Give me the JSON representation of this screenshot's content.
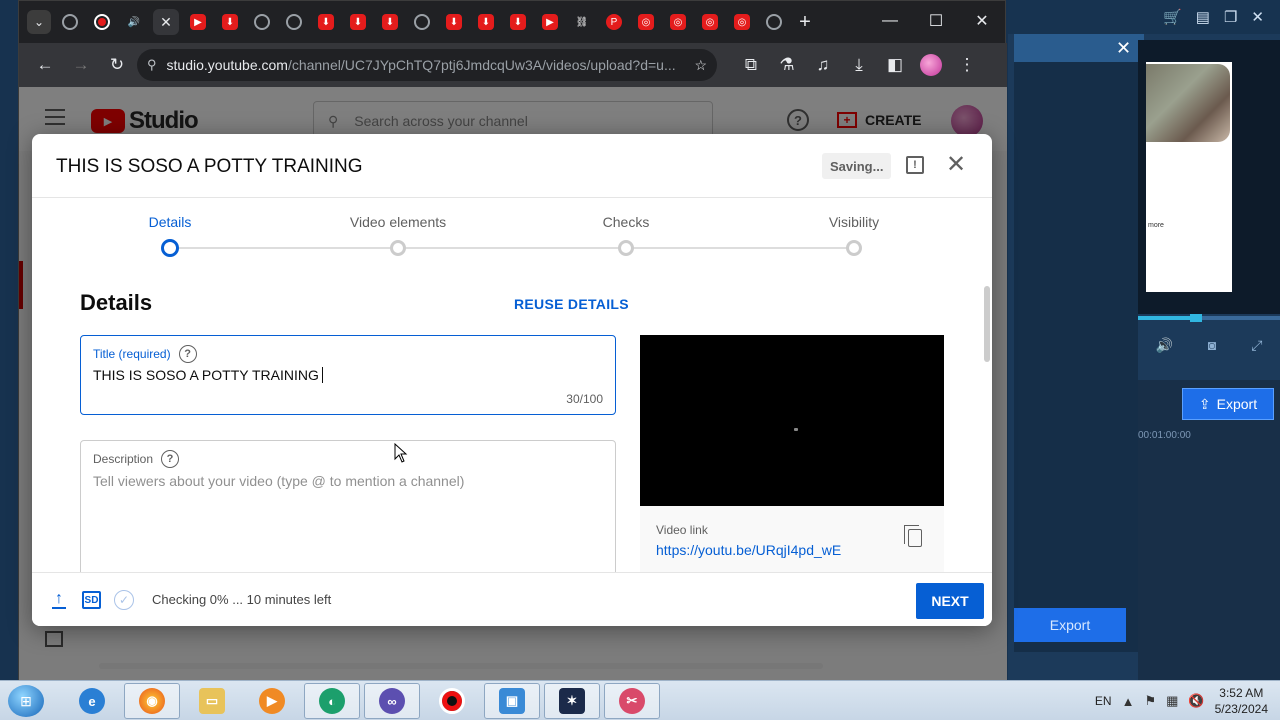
{
  "browser": {
    "url_host": "studio.youtube.com",
    "url_path": "/channel/UC7JYpChTQ7ptj6JmdcqUw3A/videos/upload?d=u..."
  },
  "studio": {
    "logo_text": "Studio",
    "search_placeholder": "Search across your channel",
    "create_label": "CREATE"
  },
  "modal": {
    "title": "THIS IS SOSO A POTTY TRAINING",
    "saving": "Saving...",
    "steps": [
      "Details",
      "Video elements",
      "Checks",
      "Visibility"
    ],
    "active_step": "Details",
    "section_heading": "Details",
    "reuse_label": "REUSE DETAILS",
    "title_field": {
      "label": "Title (required)",
      "value": "THIS IS SOSO A POTTY TRAINING",
      "counter": "30/100"
    },
    "description_field": {
      "label": "Description",
      "placeholder": "Tell viewers about your video (type @ to mention a channel)"
    },
    "video_link_label": "Video link",
    "video_link": "https://youtu.be/URqjI4pd_wE",
    "status": "Checking 0% ... 10 minutes left",
    "next_label": "NEXT"
  },
  "editor": {
    "export_label": "Export",
    "export_big_label": "Export",
    "timecode": "00:01:00:00",
    "more_text": "more"
  },
  "taskbar": {
    "lang": "EN",
    "time": "3:52 AM",
    "date": "5/23/2024"
  },
  "colors": {
    "accent": "#065fd4",
    "youtube_red": "#ff0000",
    "editor_blue": "#1e6ee8"
  }
}
